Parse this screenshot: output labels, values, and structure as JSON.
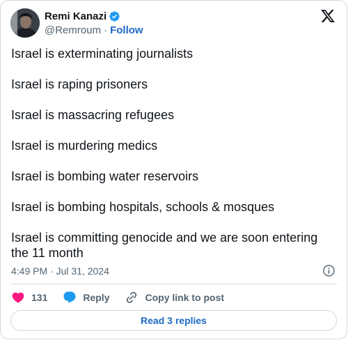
{
  "author": {
    "name": "Remi Kanazi",
    "handle": "@Remroum",
    "separator": "·",
    "follow_label": "Follow",
    "verified_color": "#1d9bf0"
  },
  "icons": {
    "verified": "verified-badge-icon",
    "x_logo": "x-logo-icon",
    "info": "info-icon",
    "like": "heart-icon",
    "reply": "speech-bubble-icon",
    "copy": "link-icon"
  },
  "tweet": {
    "lines": [
      "Israel is exterminating journalists",
      "Israel is raping prisoners",
      "Israel is massacring refugees",
      "Israel is murdering medics",
      "Israel is bombing water reservoirs",
      "Israel is bombing hospitals, schools & mosques",
      "Israel is committing genocide and we are soon entering the 11 month"
    ],
    "timestamp": "4:49 PM · Jul 31, 2024"
  },
  "actions": {
    "like_count": "131",
    "reply_label": "Reply",
    "copy_label": "Copy link to post"
  },
  "read_replies_label": "Read 3 replies",
  "colors": {
    "text": "#0f1419",
    "secondary": "#536471",
    "link": "#1d6ac4",
    "heart": "#f91880",
    "reply_bubble": "#1d9bf0",
    "border": "#cfd9de"
  }
}
